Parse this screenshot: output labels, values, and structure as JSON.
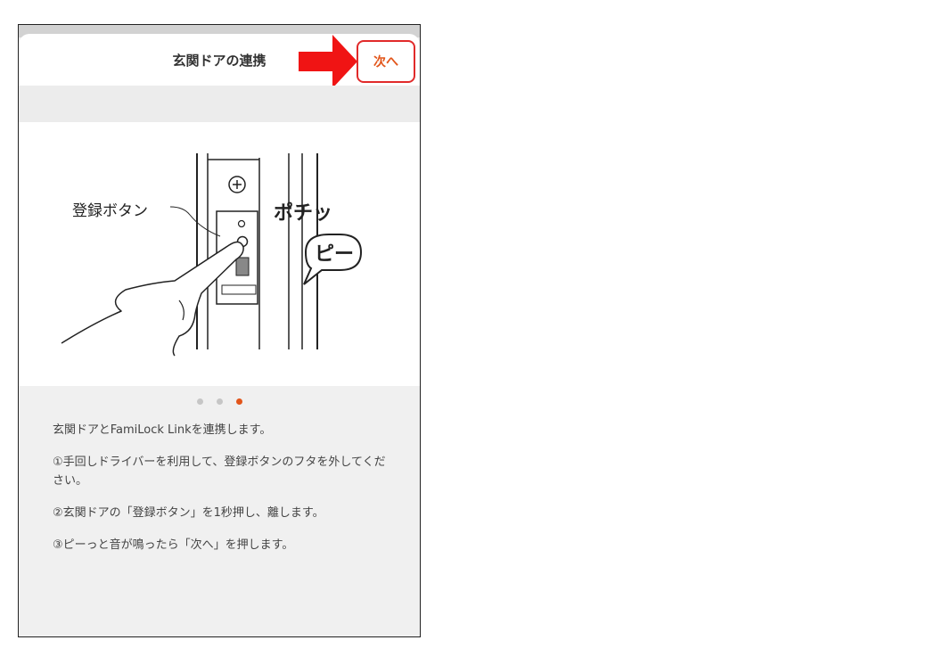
{
  "header": {
    "title": "玄関ドアの連携",
    "next_label": "次へ"
  },
  "illustration": {
    "button_label": "登録ボタン",
    "sound_click": "ポチッ",
    "sound_beep": "ピー"
  },
  "pager": {
    "count": 3,
    "active_index": 2,
    "active_color": "#e2551a"
  },
  "instructions": [
    "玄関ドアとFamiLock Linkを連携します。",
    "①手回しドライバーを利用して、登録ボタンのフタを外してください。",
    "②玄関ドアの「登録ボタン」を1秒押し、離します。",
    "③ピーっと音が鳴ったら「次へ」を押します。"
  ],
  "annotation": {
    "arrow_color": "#f01414"
  }
}
